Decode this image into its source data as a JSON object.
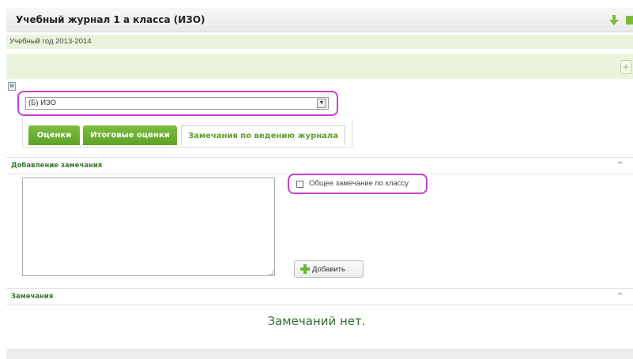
{
  "header": {
    "title": "Учебный журнал 1 а класса (ИЗО)",
    "icons": [
      "download-arrow-icon",
      "folder-icon"
    ]
  },
  "year": "Учебный год 2013-2014",
  "band": {
    "expand_icon": "plus-icon",
    "expand_label": "+"
  },
  "export_icon_label": "M",
  "subject_select": {
    "value": "(Б) ИЗО",
    "arrow": "▼"
  },
  "tabs": [
    {
      "label": "Оценки"
    },
    {
      "label": "Итоговые оценки"
    },
    {
      "label": "Замечания по ведению журнала"
    }
  ],
  "add_remark": {
    "title": "Добавление замечания",
    "caret": "^",
    "checkbox_label": "Общее замечание по классу",
    "checkbox_checked": false,
    "button_label": "Добавить"
  },
  "remarks": {
    "title": "Замечания",
    "caret": "^",
    "empty_text": "Замечаний нет."
  },
  "colors": {
    "accent_green": "#5ea326",
    "highlight": "#c83fcf",
    "band": "#eaf4dc"
  }
}
